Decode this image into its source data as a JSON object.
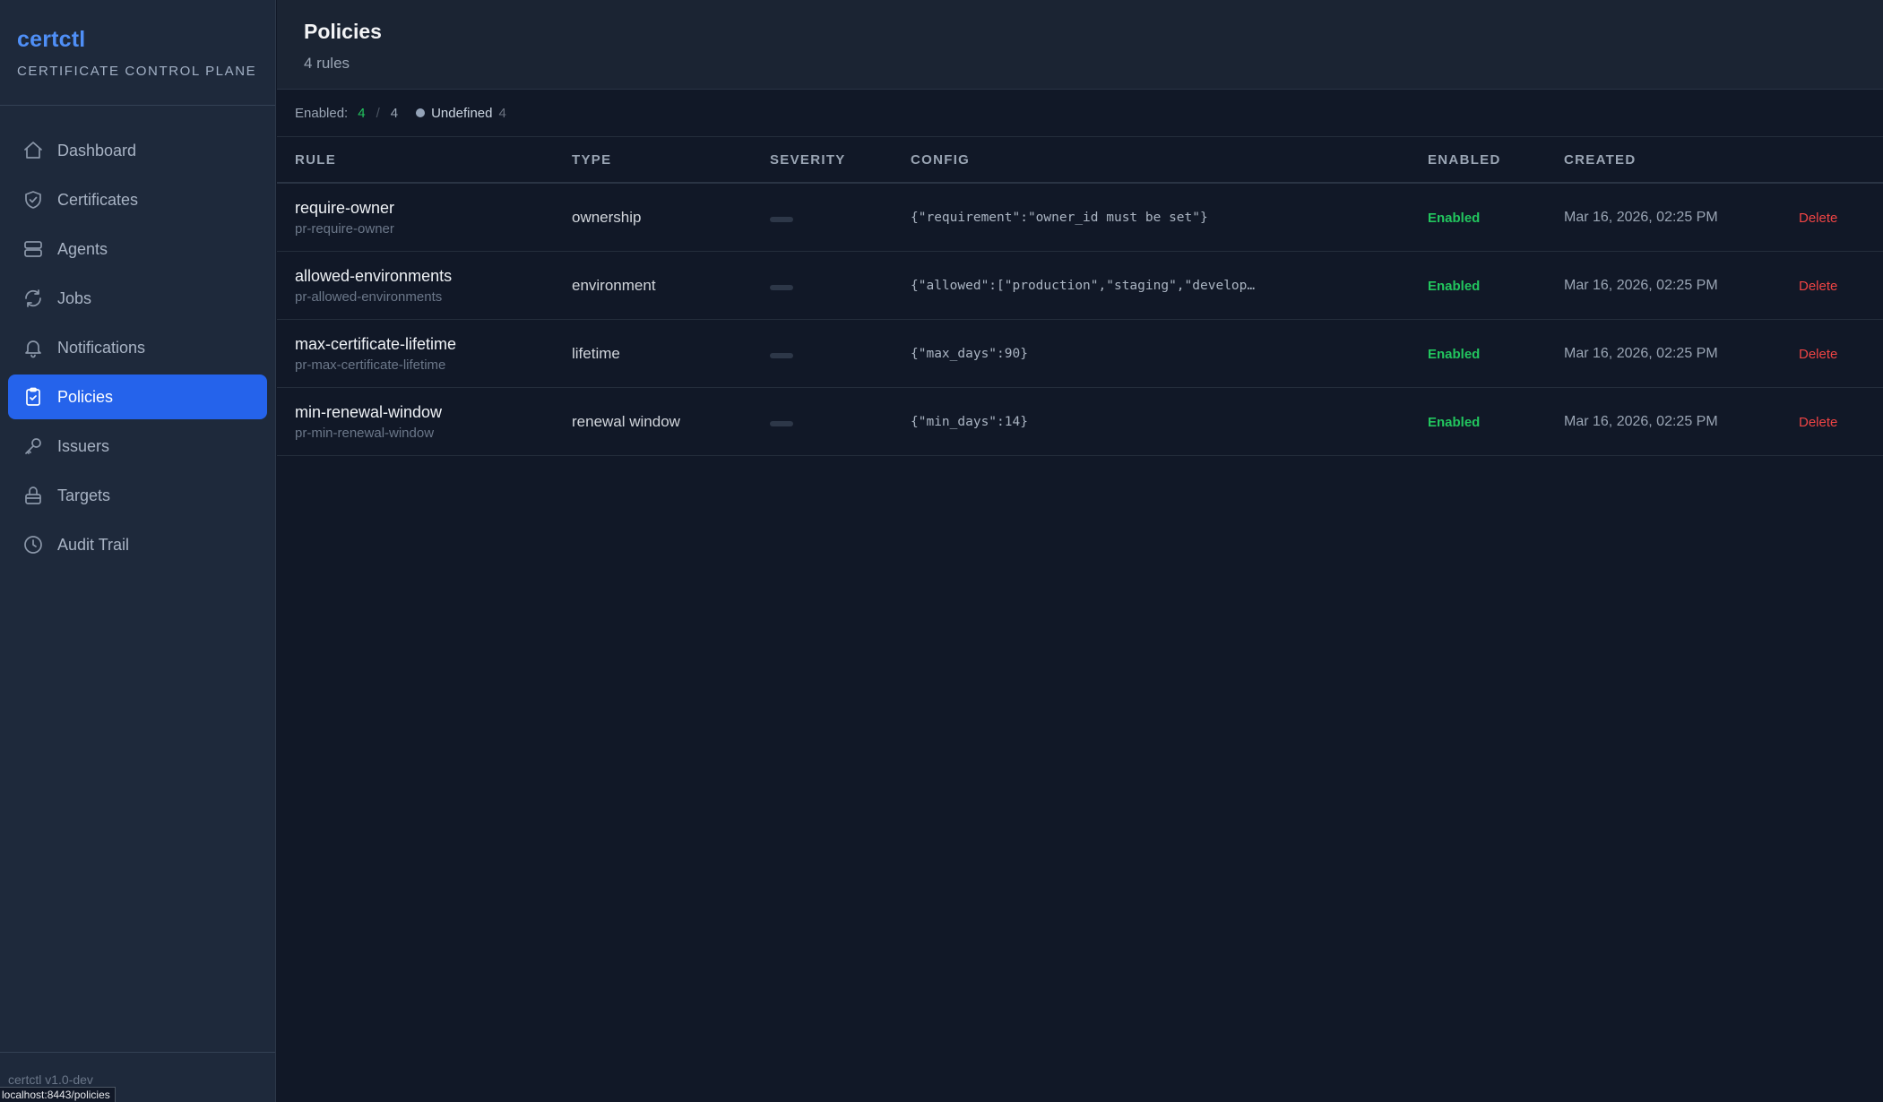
{
  "brand": {
    "name": "certctl",
    "subtitle": "CERTIFICATE CONTROL PLANE"
  },
  "sidebar": {
    "items": [
      {
        "label": "Dashboard",
        "icon": "home-icon"
      },
      {
        "label": "Certificates",
        "icon": "shield-check-icon"
      },
      {
        "label": "Agents",
        "icon": "server-icon"
      },
      {
        "label": "Jobs",
        "icon": "refresh-icon"
      },
      {
        "label": "Notifications",
        "icon": "bell-icon"
      },
      {
        "label": "Policies",
        "icon": "clipboard-check-icon",
        "active": true
      },
      {
        "label": "Issuers",
        "icon": "key-icon"
      },
      {
        "label": "Targets",
        "icon": "lock-icon"
      },
      {
        "label": "Audit Trail",
        "icon": "clock-icon"
      }
    ],
    "version": "certctl v1.0-dev",
    "status_url": "localhost:8443/policies"
  },
  "header": {
    "title": "Policies",
    "subtitle": "4 rules"
  },
  "summary": {
    "enabled_label": "Enabled:",
    "enabled_count": "4",
    "separator": "/",
    "total": "4",
    "undefined_label": "Undefined",
    "undefined_count": "4"
  },
  "table": {
    "columns": [
      "RULE",
      "TYPE",
      "SEVERITY",
      "CONFIG",
      "ENABLED",
      "CREATED",
      ""
    ],
    "rows": [
      {
        "name": "require-owner",
        "id": "pr-require-owner",
        "type": "ownership",
        "config": "{\"requirement\":\"owner_id must be set\"}",
        "enabled": "Enabled",
        "created": "Mar 16, 2026, 02:25 PM",
        "action": "Delete"
      },
      {
        "name": "allowed-environments",
        "id": "pr-allowed-environments",
        "type": "environment",
        "config": "{\"allowed\":[\"production\",\"staging\",\"develop…",
        "enabled": "Enabled",
        "created": "Mar 16, 2026, 02:25 PM",
        "action": "Delete"
      },
      {
        "name": "max-certificate-lifetime",
        "id": "pr-max-certificate-lifetime",
        "type": "lifetime",
        "config": "{\"max_days\":90}",
        "enabled": "Enabled",
        "created": "Mar 16, 2026, 02:25 PM",
        "action": "Delete"
      },
      {
        "name": "min-renewal-window",
        "id": "pr-min-renewal-window",
        "type": "renewal window",
        "config": "{\"min_days\":14}",
        "enabled": "Enabled",
        "created": "Mar 16, 2026, 02:25 PM",
        "action": "Delete"
      }
    ]
  },
  "colors": {
    "accent": "#2563eb",
    "brand": "#4f8ff7",
    "enabled": "#22c55e",
    "danger": "#ef4444"
  }
}
